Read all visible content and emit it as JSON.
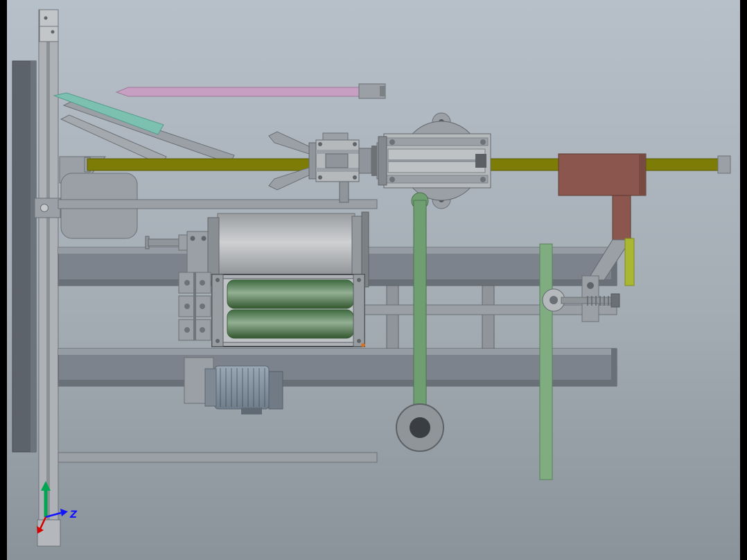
{
  "viewport": {
    "kind": "cad-assembly-view"
  },
  "triad": {
    "z_label": "Z"
  },
  "palette": {
    "bg_top": "#b7c0c9",
    "bg_mid": "#a4acb4",
    "bg_bottom": "#8a929a",
    "letterbox": "#000000",
    "pink": "#c79fc2",
    "teal": "#7cc0af",
    "olive": "#7c7c06",
    "olive_dark": "#5b5b04",
    "brown": "#8a564e",
    "green_rod": "#6f9f70",
    "green_roller": "#4d7d4f",
    "motor_blue": "#8795a4",
    "yellow_green": "#aab733",
    "axis_green": "#00a651",
    "axis_red": "#d40000",
    "axis_blue": "#1414ff"
  }
}
